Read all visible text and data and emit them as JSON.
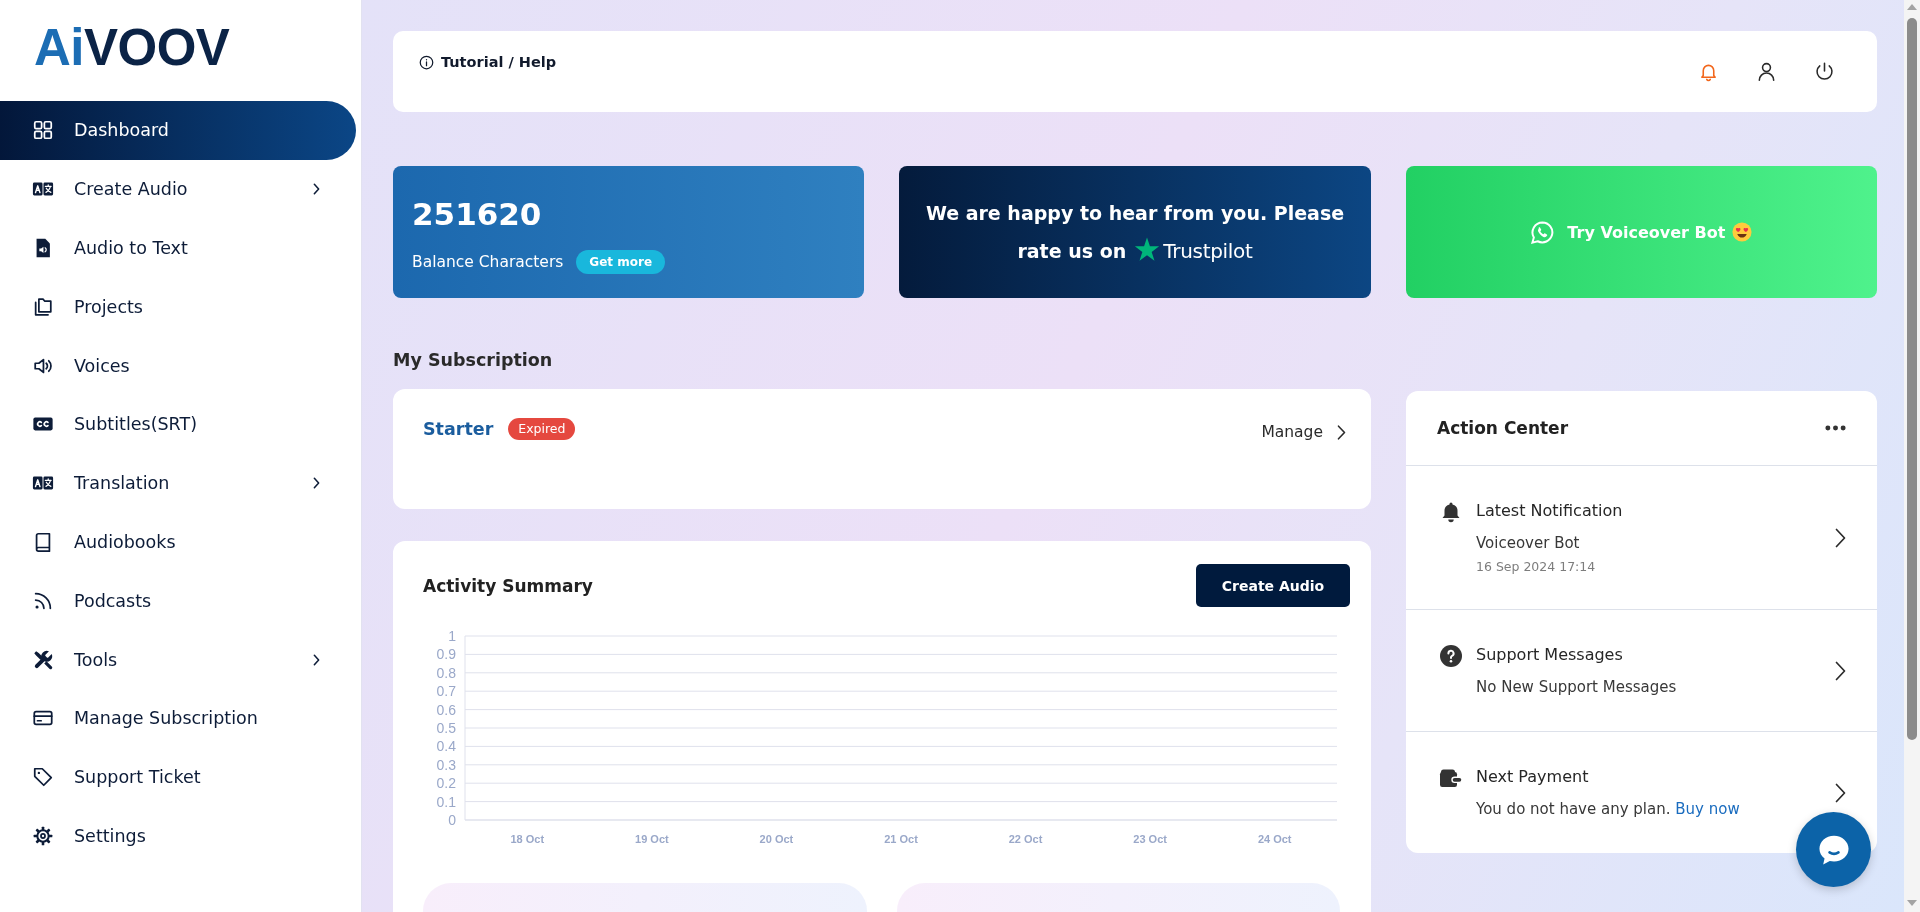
{
  "sidebar": {
    "logo": {
      "accent": "Ai",
      "text": "VOOV"
    },
    "items": [
      {
        "label": "Dashboard",
        "selected": true,
        "expandable": false
      },
      {
        "label": "Create Audio",
        "selected": false,
        "expandable": true
      },
      {
        "label": "Audio to Text",
        "selected": false,
        "expandable": false
      },
      {
        "label": "Projects",
        "selected": false,
        "expandable": false
      },
      {
        "label": "Voices",
        "selected": false,
        "expandable": false
      },
      {
        "label": "Subtitles(SRT)",
        "selected": false,
        "expandable": false
      },
      {
        "label": "Translation",
        "selected": false,
        "expandable": true
      },
      {
        "label": "Audiobooks",
        "selected": false,
        "expandable": false
      },
      {
        "label": "Podcasts",
        "selected": false,
        "expandable": false
      },
      {
        "label": "Tools",
        "selected": false,
        "expandable": true
      },
      {
        "label": "Manage Subscription",
        "selected": false,
        "expandable": false
      },
      {
        "label": "Support Ticket",
        "selected": false,
        "expandable": false
      },
      {
        "label": "Settings",
        "selected": false,
        "expandable": false
      }
    ]
  },
  "header": {
    "help_link": "Tutorial / Help",
    "notifications_unread": true
  },
  "balance_card": {
    "value": "251620",
    "label": "Balance Characters",
    "button": "Get more"
  },
  "rating_banner": {
    "lines": [
      "We are happy to hear from you. Please",
      "rate us on"
    ],
    "brand": "Trustpilot"
  },
  "bot_banner": {
    "label": "Try Voiceover Bot"
  },
  "subscription": {
    "heading": "My Subscription",
    "plan": "Starter",
    "status": "Expired",
    "manage": "Manage"
  },
  "activity": {
    "title": "Activity Summary",
    "button": "Create Audio",
    "chart_data": {
      "type": "bar",
      "categories": [
        "18 Oct",
        "19 Oct",
        "20 Oct",
        "21 Oct",
        "22 Oct",
        "23 Oct",
        "24 Oct"
      ],
      "values": [
        null,
        null,
        null,
        null,
        null,
        null,
        null
      ],
      "ylim": [
        0,
        1
      ],
      "yticks": [
        0,
        0.1,
        0.2,
        0.3,
        0.4,
        0.5,
        0.6,
        0.7,
        0.8,
        0.9,
        1
      ],
      "grid": true
    }
  },
  "action_center": {
    "title": "Action Center",
    "items": [
      {
        "title": "Latest Notification",
        "detail": "Voiceover Bot",
        "time": "16 Sep 2024 17:14"
      },
      {
        "title": "Support Messages",
        "detail": "No New Support Messages"
      },
      {
        "title": "Next Payment",
        "detail": "You do not have any plan.",
        "link": "Buy now"
      }
    ]
  }
}
